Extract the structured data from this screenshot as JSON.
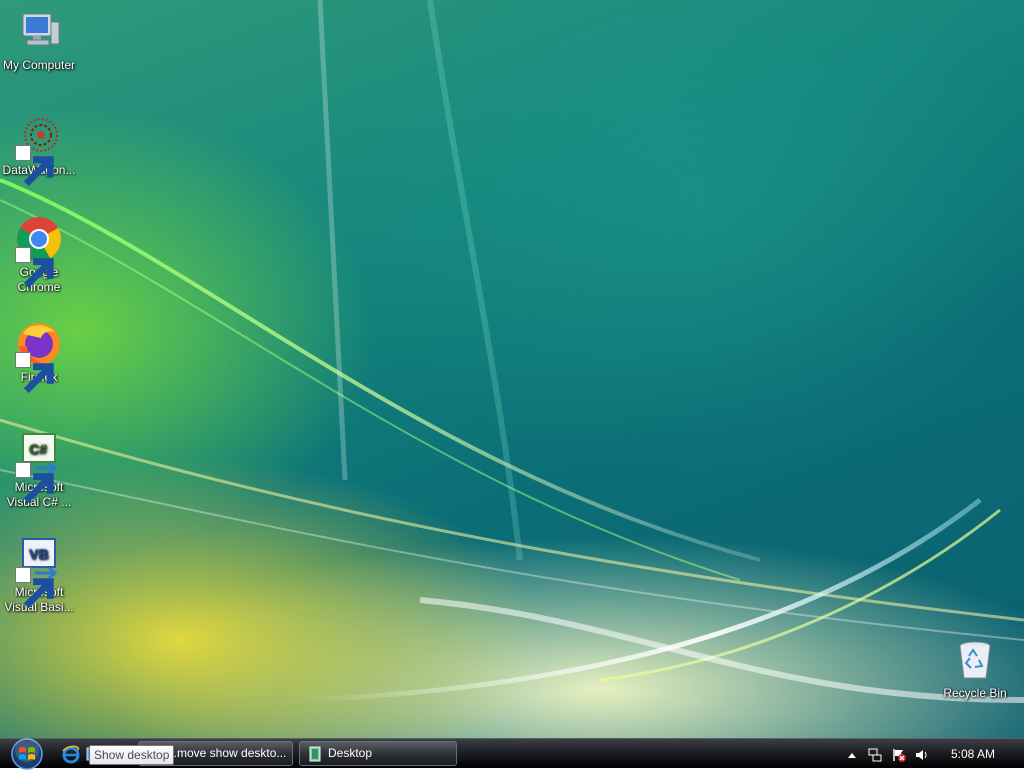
{
  "desktop_icons": [
    {
      "label": "My Computer",
      "icon": "computer-icon"
    },
    {
      "label": "DataWagon...",
      "icon": "datawagon-icon"
    },
    {
      "label": "Google Chrome",
      "icon": "chrome-icon"
    },
    {
      "label": "Firefox",
      "icon": "firefox-icon"
    },
    {
      "label": "Microsoft Visual C# ...",
      "icon": "visual-csharp-icon"
    },
    {
      "label": "Microsoft Visual Basi...",
      "icon": "visual-basic-icon"
    }
  ],
  "recycle_bin": {
    "label": "Recycle Bin",
    "icon": "recycle-bin-icon"
  },
  "taskbar": {
    "start_icon": "windows-orb-icon",
    "quick_launch": [
      "internet-explorer-icon",
      "show-desktop-icon"
    ],
    "tooltip": "Show desktop",
    "buttons": [
      {
        "label": "...move show deskto...",
        "icon": "window-icon"
      },
      {
        "label": "Desktop",
        "icon": "folder-icon"
      }
    ],
    "tray_icons": [
      "show-hidden-icons-arrow",
      "network-icon",
      "security-alert-icon",
      "volume-icon"
    ],
    "clock": "5:08 AM"
  },
  "colors": {
    "desktop_teal": "#0b6f76",
    "desktop_green": "#5fd04a",
    "desktop_yellow": "#e6de3c",
    "taskbar": "#1d2024"
  }
}
